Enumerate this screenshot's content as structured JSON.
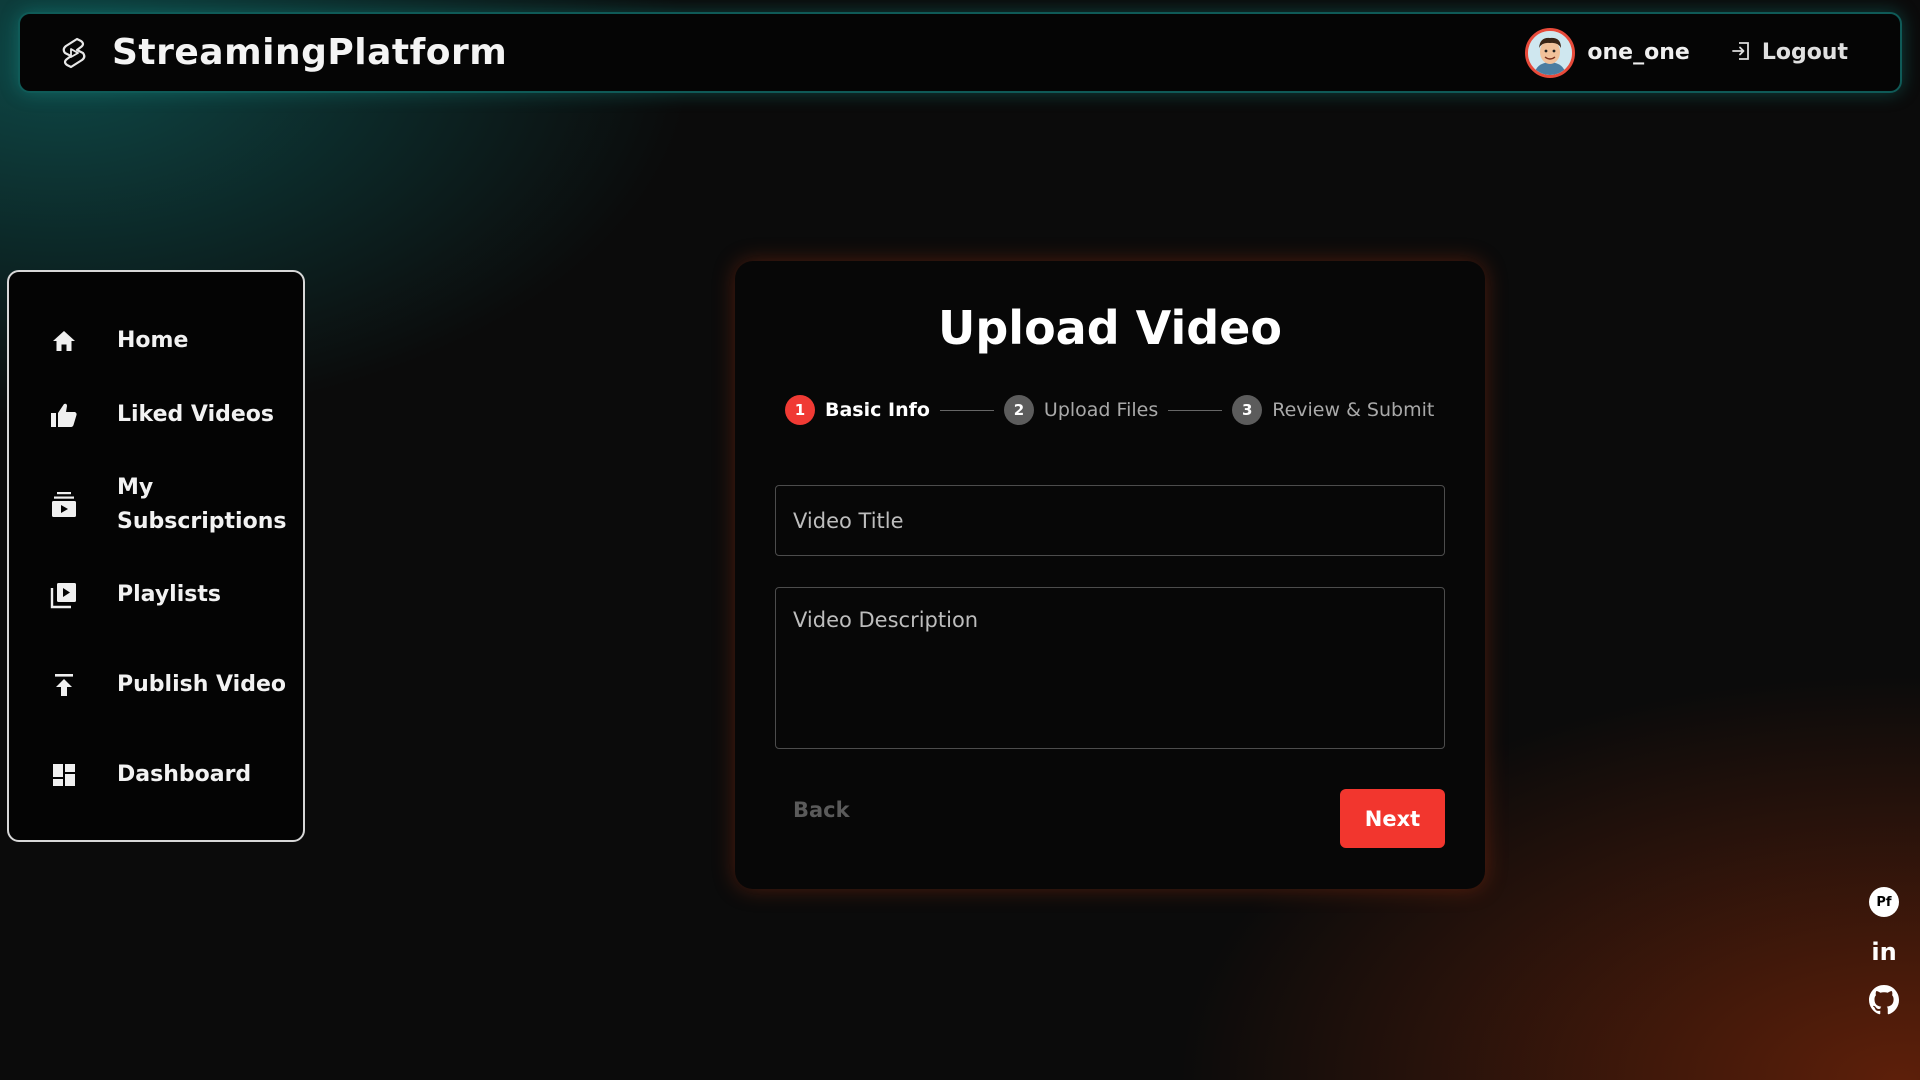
{
  "app": {
    "brand_name": "StreamingPlatform",
    "logo_icon": "lightning-play-icon"
  },
  "header": {
    "username": "one_one",
    "logout_label": "Logout"
  },
  "sidebar": {
    "items": [
      {
        "label": "Home",
        "icon": "home-icon"
      },
      {
        "label": "Liked Videos",
        "icon": "thumbs-up-icon"
      },
      {
        "label": "My Subscriptions",
        "icon": "subscriptions-icon"
      },
      {
        "label": "Playlists",
        "icon": "playlist-icon"
      },
      {
        "label": "Publish Video",
        "icon": "upload-icon"
      },
      {
        "label": "Dashboard",
        "icon": "dashboard-icon"
      }
    ]
  },
  "upload": {
    "title": "Upload Video",
    "steps": [
      {
        "number": "1",
        "label": "Basic Info",
        "state": "active"
      },
      {
        "number": "2",
        "label": "Upload Files",
        "state": "inactive"
      },
      {
        "number": "3",
        "label": "Review & Submit",
        "state": "inactive"
      }
    ],
    "title_placeholder": "Video Title",
    "description_placeholder": "Video Description",
    "back_label": "Back",
    "next_label": "Next"
  },
  "social": {
    "items": [
      {
        "label": "Pf",
        "icon": "portfolio-icon"
      },
      {
        "label": "in",
        "icon": "linkedin-icon"
      },
      {
        "label": "",
        "icon": "github-icon"
      }
    ]
  },
  "colors": {
    "accent": "#f2362e",
    "header_border": "#0f5a57",
    "step_inactive": "#5c5c5c"
  }
}
